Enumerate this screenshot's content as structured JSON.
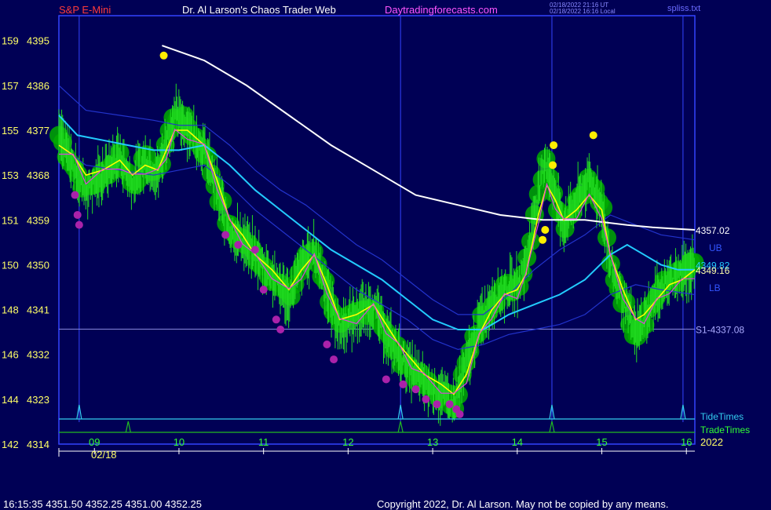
{
  "header": {
    "symbol": "S&P E-Mini",
    "site": "Dr. Al Larson's Chaos Trader Web",
    "link": "Daytradingforecasts.com",
    "timestamp_utc": "02/18/2022 21:16 UT",
    "timestamp_local": "02/18/2022 16:16 Local",
    "file": "spliss.txt"
  },
  "footer": {
    "quote": "16:15:35  4351.50 4352.25 4351.00 4352.25",
    "copyright": "Copyright 2022, Dr. Al Larson. May not be copied by any means."
  },
  "colors": {
    "background": "#000055",
    "frame": "#3344ff",
    "price_bars": "#22dd22",
    "glow": "#00aa00",
    "sma_white": "#ffffff",
    "band_cyan": "#22ccff",
    "band_blue": "#2233cc",
    "avg_yellow": "#ffff00",
    "avg_magenta": "#dd44dd",
    "signal_yellow": "#ffee00",
    "signal_magenta": "#aa22aa",
    "tide_line": "#33ccee",
    "trade_line": "#22bb22"
  },
  "chart_data": {
    "type": "line",
    "title": "S&P E-Mini",
    "xlabel": "",
    "ylabel": "",
    "ylim": [
      4314,
      4400
    ],
    "y_ticks": [
      {
        "left": "159",
        "price": 4395
      },
      {
        "left": "157",
        "price": 4386
      },
      {
        "left": "155",
        "price": 4377
      },
      {
        "left": "153",
        "price": 4368
      },
      {
        "left": "151",
        "price": 4359
      },
      {
        "left": "150",
        "price": 4350
      },
      {
        "left": "148",
        "price": 4341
      },
      {
        "left": "146",
        "price": 4332
      },
      {
        "left": "144",
        "price": 4323
      },
      {
        "left": "142",
        "price": 4314
      }
    ],
    "x_range": [
      8.58,
      16.1
    ],
    "x_ticks": [
      "09",
      "10",
      "11",
      "12",
      "13",
      "14",
      "15",
      "16"
    ],
    "date_label": "02/18",
    "year_label": "2022",
    "series": [
      {
        "key": "price",
        "x": [
          8.58,
          8.75,
          8.9,
          9.1,
          9.3,
          9.45,
          9.6,
          9.75,
          9.85,
          9.95,
          10.1,
          10.3,
          10.45,
          10.6,
          10.75,
          10.9,
          11.1,
          11.3,
          11.45,
          11.6,
          11.75,
          11.9,
          12.1,
          12.3,
          12.45,
          12.6,
          12.75,
          12.9,
          13.1,
          13.25,
          13.4,
          13.55,
          13.7,
          13.85,
          14.0,
          14.1,
          14.25,
          14.35,
          14.45,
          14.55,
          14.7,
          14.85,
          15.0,
          15.1,
          15.25,
          15.4,
          15.5,
          15.65,
          15.8,
          15.95,
          16.1
        ],
        "y": [
          4376,
          4370,
          4365,
          4368,
          4372,
          4366,
          4371,
          4368,
          4375,
          4380,
          4378,
          4373,
          4365,
          4357,
          4355,
          4352,
          4348,
          4343,
          4350,
          4353,
          4345,
          4337,
          4340,
          4342,
          4336,
          4332,
          4329,
          4326,
          4324,
          4322,
          4330,
          4338,
          4343,
          4345,
          4346,
          4350,
          4365,
          4371,
          4364,
          4358,
          4363,
          4367,
          4362,
          4350,
          4343,
          4336,
          4339,
          4344,
          4347,
          4348,
          4350
        ]
      },
      {
        "key": "sma_white",
        "name": "",
        "x": [
          9.8,
          10.3,
          10.8,
          11.3,
          11.8,
          12.3,
          12.8,
          13.3,
          13.8,
          14.3,
          14.8,
          15.3,
          15.6,
          15.9,
          16.1
        ],
        "y": [
          4394,
          4391,
          4386,
          4380,
          4374,
          4369,
          4364,
          4362,
          4360,
          4359,
          4359,
          4358,
          4357.5,
          4357.2,
          4357.0
        ]
      },
      {
        "key": "band_cyan",
        "name": "",
        "x": [
          8.58,
          8.8,
          9.1,
          9.4,
          9.7,
          10.0,
          10.3,
          10.6,
          10.9,
          11.2,
          11.5,
          11.8,
          12.1,
          12.4,
          12.7,
          13.0,
          13.3,
          13.6,
          13.9,
          14.2,
          14.5,
          14.8,
          15.1,
          15.3,
          15.5,
          15.7,
          15.9,
          16.1
        ],
        "y": [
          4380,
          4376,
          4375,
          4374,
          4373,
          4373,
          4374,
          4370,
          4365,
          4361,
          4357,
          4353,
          4350,
          4347,
          4343,
          4339,
          4337,
          4337,
          4340,
          4342,
          4344,
          4347,
          4352,
          4354,
          4352,
          4350,
          4349,
          4349
        ]
      },
      {
        "key": "band_upper",
        "name": "",
        "x": [
          8.58,
          8.9,
          9.3,
          9.7,
          10.0,
          10.3,
          10.6,
          10.9,
          11.2,
          11.5,
          11.8,
          12.1,
          12.4,
          12.7,
          13.0,
          13.3,
          13.6,
          13.9,
          14.2,
          14.5,
          14.8,
          15.1,
          15.4,
          15.7,
          16.1
        ],
        "y": [
          4386,
          4381,
          4380,
          4379,
          4378,
          4378,
          4374,
          4369,
          4365,
          4362,
          4358,
          4354,
          4351,
          4347,
          4343,
          4340,
          4340,
          4344,
          4349,
          4353,
          4356,
          4360,
          4358,
          4356,
          4355
        ]
      },
      {
        "key": "band_lower",
        "name": "",
        "x": [
          8.58,
          8.9,
          9.3,
          9.7,
          10.0,
          10.3,
          10.6,
          10.9,
          11.2,
          11.5,
          11.8,
          12.1,
          12.4,
          12.7,
          13.0,
          13.3,
          13.6,
          13.9,
          14.2,
          14.5,
          14.8,
          15.1,
          15.4,
          15.7,
          16.1
        ],
        "y": [
          4374,
          4370,
          4369,
          4368,
          4369,
          4370,
          4366,
          4361,
          4357,
          4353,
          4349,
          4345,
          4342,
          4339,
          4335,
          4333,
          4334,
          4336,
          4337,
          4338,
          4340,
          4344,
          4346,
          4345,
          4344
        ]
      },
      {
        "key": "avg_yellow",
        "name": "",
        "x": [
          8.58,
          8.75,
          8.9,
          9.1,
          9.3,
          9.45,
          9.6,
          9.75,
          9.85,
          9.95,
          10.1,
          10.3,
          10.45,
          10.6,
          10.75,
          10.9,
          11.1,
          11.3,
          11.45,
          11.6,
          11.75,
          11.9,
          12.1,
          12.3,
          12.45,
          12.6,
          12.75,
          12.9,
          13.1,
          13.25,
          13.4,
          13.55,
          13.7,
          13.85,
          14.0,
          14.1,
          14.25,
          14.35,
          14.45,
          14.55,
          14.7,
          14.85,
          15.0,
          15.1,
          15.25,
          15.4,
          15.5,
          15.65,
          15.8,
          15.95,
          16.1
        ],
        "y": [
          4374,
          4372,
          4368,
          4369,
          4371,
          4368,
          4370,
          4369,
          4373,
          4377,
          4377,
          4374,
          4367,
          4359,
          4356,
          4352,
          4349,
          4345,
          4349,
          4352,
          4346,
          4339,
          4340,
          4342,
          4338,
          4334,
          4331,
          4328,
          4326,
          4324,
          4328,
          4336,
          4341,
          4344,
          4345,
          4348,
          4360,
          4366,
          4363,
          4359,
          4361,
          4364,
          4361,
          4352,
          4345,
          4339,
          4340,
          4343,
          4346,
          4347,
          4349
        ]
      }
    ],
    "signals_yellow": [
      {
        "x": 9.82,
        "y": 4392
      },
      {
        "x": 14.43,
        "y": 4374
      },
      {
        "x": 14.42,
        "y": 4370
      },
      {
        "x": 14.33,
        "y": 4357
      },
      {
        "x": 14.3,
        "y": 4355
      },
      {
        "x": 14.9,
        "y": 4376
      }
    ],
    "signals_magenta": [
      {
        "x": 8.77,
        "y": 4364
      },
      {
        "x": 8.8,
        "y": 4360
      },
      {
        "x": 8.82,
        "y": 4358
      },
      {
        "x": 10.55,
        "y": 4356
      },
      {
        "x": 10.7,
        "y": 4354
      },
      {
        "x": 10.9,
        "y": 4353
      },
      {
        "x": 11.0,
        "y": 4345
      },
      {
        "x": 11.15,
        "y": 4339
      },
      {
        "x": 11.2,
        "y": 4337
      },
      {
        "x": 11.75,
        "y": 4334
      },
      {
        "x": 11.83,
        "y": 4331
      },
      {
        "x": 12.45,
        "y": 4327
      },
      {
        "x": 12.65,
        "y": 4326
      },
      {
        "x": 12.8,
        "y": 4325
      },
      {
        "x": 12.92,
        "y": 4323
      },
      {
        "x": 13.05,
        "y": 4322
      },
      {
        "x": 13.2,
        "y": 4322
      },
      {
        "x": 13.28,
        "y": 4321
      },
      {
        "x": 13.32,
        "y": 4320
      }
    ],
    "price_labels": [
      {
        "text": "4357.02",
        "y": 4357.02,
        "color": "#ffffff"
      },
      {
        "text": "UB",
        "y": 4353.5,
        "color": "#3355ff"
      },
      {
        "text": "4349.82",
        "y": 4350.0,
        "color": "#22ccff"
      },
      {
        "text": "4349.16",
        "y": 4349.0,
        "color": "#ffffaa"
      },
      {
        "text": "LB",
        "y": 4345.5,
        "color": "#3355ff"
      },
      {
        "text": "S1-4337.08",
        "y": 4337.08,
        "color": "#aaaaff"
      }
    ],
    "s1_level": 4337.08,
    "tide_times": [
      8.82,
      12.62,
      14.41,
      15.96
    ],
    "trade_times": [
      9.4,
      12.62,
      14.41
    ],
    "timing_labels": {
      "tide": "TideTimes",
      "trade": "TradeTimes"
    }
  }
}
